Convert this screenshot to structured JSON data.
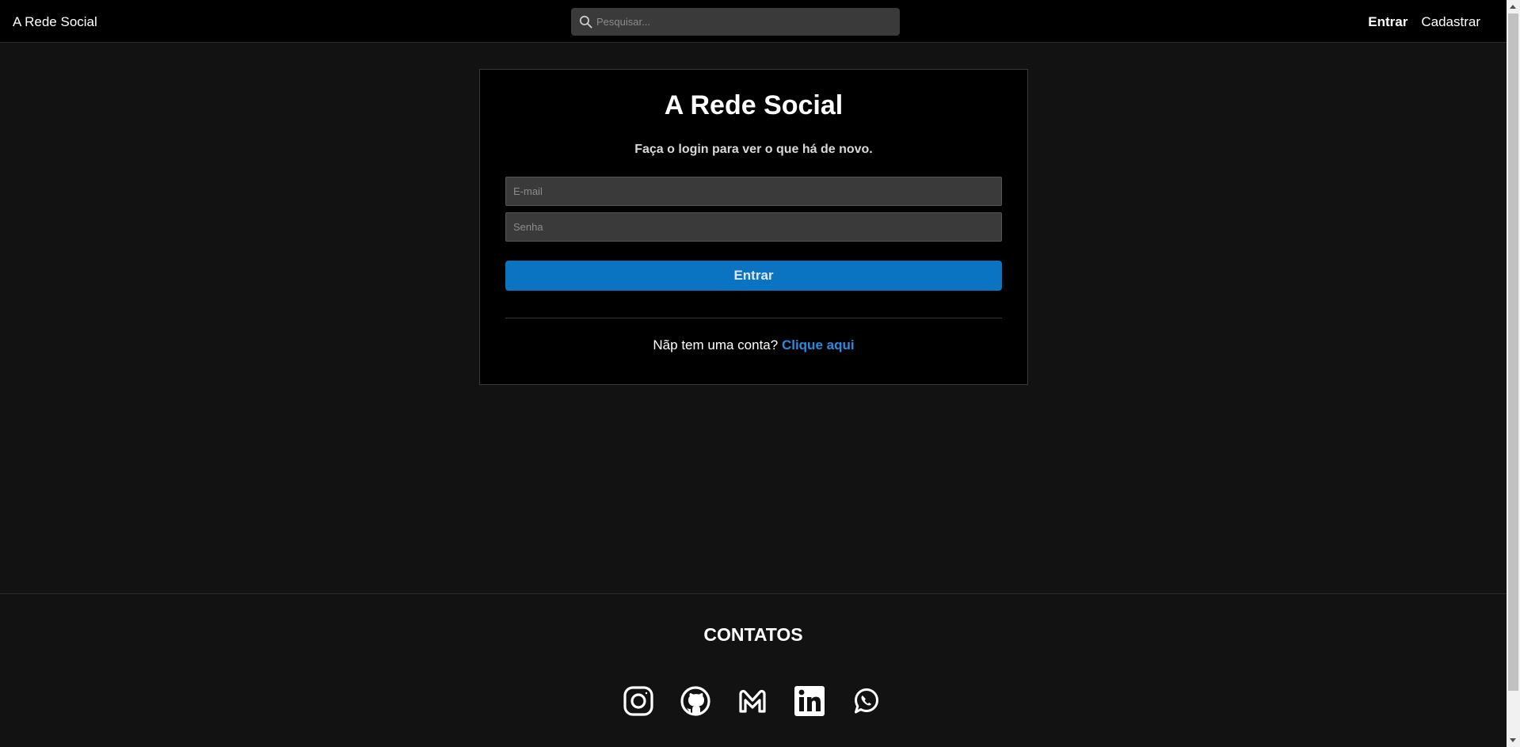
{
  "navbar": {
    "brand": "A Rede Social",
    "search_placeholder": "Pesquisar...",
    "links": [
      {
        "label": "Entrar",
        "active": true
      },
      {
        "label": "Cadastrar",
        "active": false
      }
    ]
  },
  "login": {
    "title": "A Rede Social",
    "subtitle": "Faça o login para ver o que há de novo.",
    "email_placeholder": "E-mail",
    "password_placeholder": "Senha",
    "submit_label": "Entrar",
    "signup_prompt": "Nãp tem uma conta?",
    "signup_link": "Clique aqui"
  },
  "footer": {
    "title": "CONTATOS",
    "socials": [
      "instagram-icon",
      "github-icon",
      "gmail-icon",
      "linkedin-icon",
      "whatsapp-icon"
    ]
  },
  "colors": {
    "background": "#121212",
    "navbar": "#000000",
    "card": "#000000",
    "accent": "#0a74c2",
    "link": "#2a8be0"
  }
}
